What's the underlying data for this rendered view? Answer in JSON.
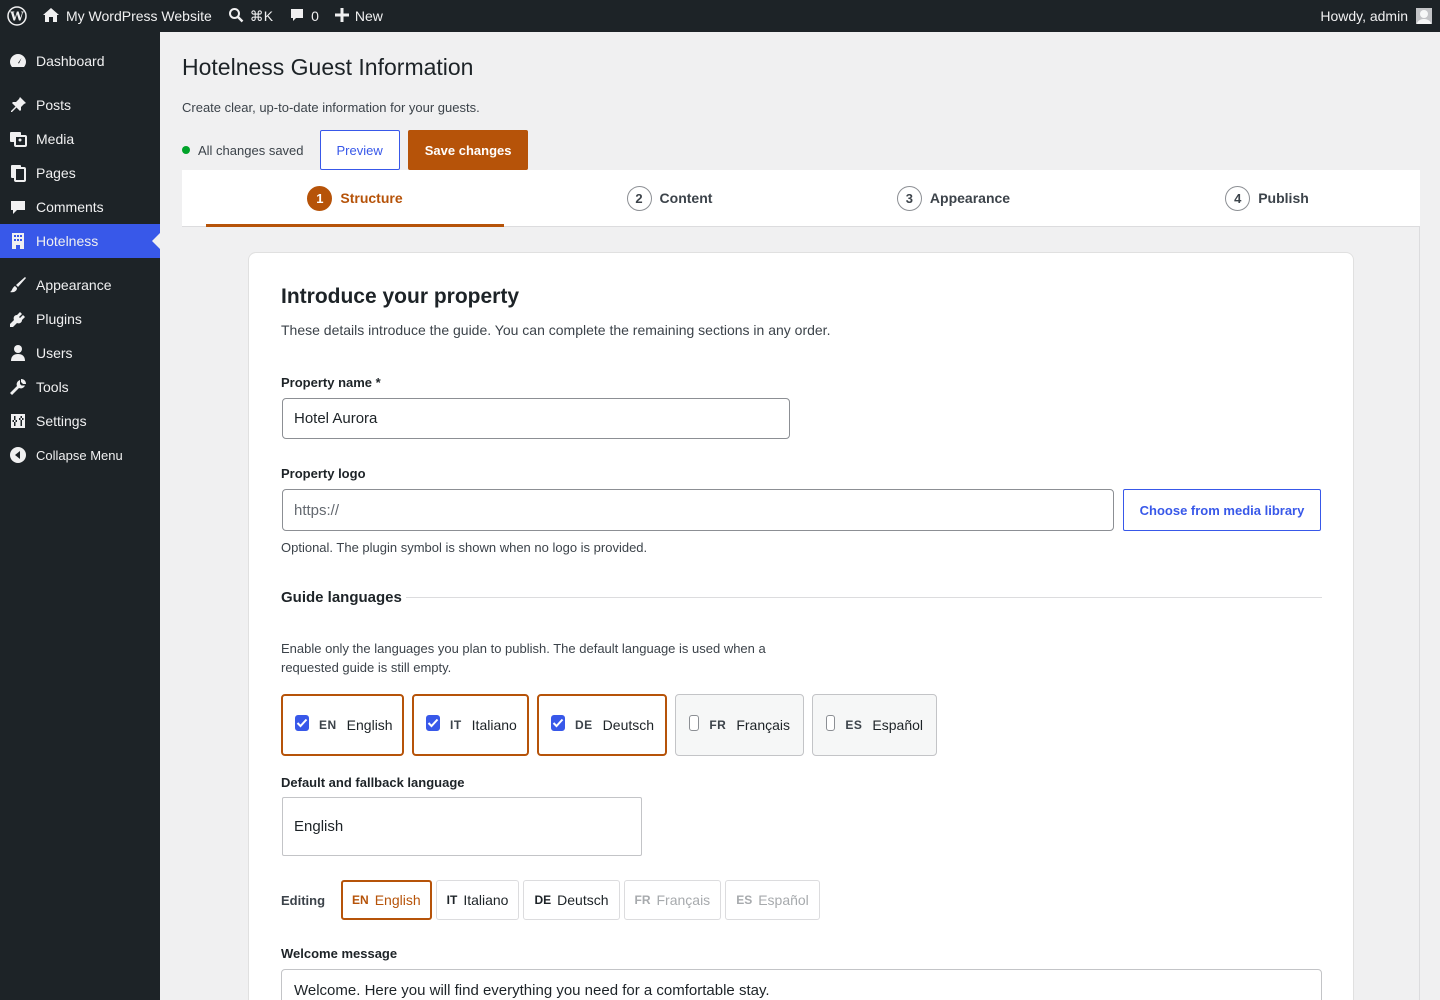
{
  "adminbar": {
    "site_name": "My WordPress Website",
    "search_shortcut": "⌘K",
    "comments_count": "0",
    "new_label": "New",
    "greeting": "Howdy, admin"
  },
  "sidebar": {
    "items": [
      {
        "label": "Dashboard",
        "icon": "dashboard-icon"
      },
      {
        "label": "Posts",
        "icon": "pin-icon"
      },
      {
        "label": "Media",
        "icon": "media-icon"
      },
      {
        "label": "Pages",
        "icon": "pages-icon"
      },
      {
        "label": "Comments",
        "icon": "comment-icon"
      },
      {
        "label": "Hotelness",
        "icon": "building-icon"
      },
      {
        "label": "Appearance",
        "icon": "brush-icon"
      },
      {
        "label": "Plugins",
        "icon": "plugin-icon"
      },
      {
        "label": "Users",
        "icon": "user-icon"
      },
      {
        "label": "Tools",
        "icon": "wrench-icon"
      },
      {
        "label": "Settings",
        "icon": "settings-icon"
      }
    ],
    "collapse_label": "Collapse Menu",
    "active": "Hotelness"
  },
  "page": {
    "title": "Hotelness Guest Information",
    "description": "Create clear, up-to-date information for your guests.",
    "save_status": "All changes saved",
    "preview_label": "Preview",
    "save_label": "Save changes"
  },
  "steps": [
    {
      "num": "1",
      "label": "Structure",
      "active": true
    },
    {
      "num": "2",
      "label": "Content"
    },
    {
      "num": "3",
      "label": "Appearance"
    },
    {
      "num": "4",
      "label": "Publish"
    }
  ],
  "card": {
    "title": "Introduce your property",
    "description": "These details introduce the guide. You can complete the remaining sections in any order.",
    "property_name_label": "Property name *",
    "property_name_value": "Hotel Aurora",
    "logo_label": "Property logo",
    "logo_placeholder": "https://",
    "media_button": "Choose from media library",
    "logo_help": "Optional. The plugin symbol is shown when no logo is provided.",
    "languages_heading": "Guide languages",
    "languages_desc": "Enable only the languages you plan to publish. The default language is used when a requested guide is still empty.",
    "languages": [
      {
        "code": "EN",
        "name": "English",
        "checked": true
      },
      {
        "code": "IT",
        "name": "Italiano",
        "checked": true
      },
      {
        "code": "DE",
        "name": "Deutsch",
        "checked": true
      },
      {
        "code": "FR",
        "name": "Français",
        "checked": false
      },
      {
        "code": "ES",
        "name": "Español",
        "checked": false
      }
    ],
    "default_lang_label": "Default and fallback language",
    "default_lang_value": "English",
    "editing_label": "Editing",
    "editing_tabs": [
      {
        "code": "EN",
        "name": "English",
        "state": "active"
      },
      {
        "code": "IT",
        "name": "Italiano",
        "state": "enabled"
      },
      {
        "code": "DE",
        "name": "Deutsch",
        "state": "enabled"
      },
      {
        "code": "FR",
        "name": "Français",
        "state": "disabled"
      },
      {
        "code": "ES",
        "name": "Español",
        "state": "disabled"
      }
    ],
    "welcome_label": "Welcome message",
    "welcome_value": "Welcome. Here you will find everything you need for a comfortable stay."
  },
  "colors": {
    "accent": "#b65309",
    "admin_blue": "#3858e9",
    "adminbar_bg": "#1d2327",
    "saved_dot": "#00a32a"
  }
}
